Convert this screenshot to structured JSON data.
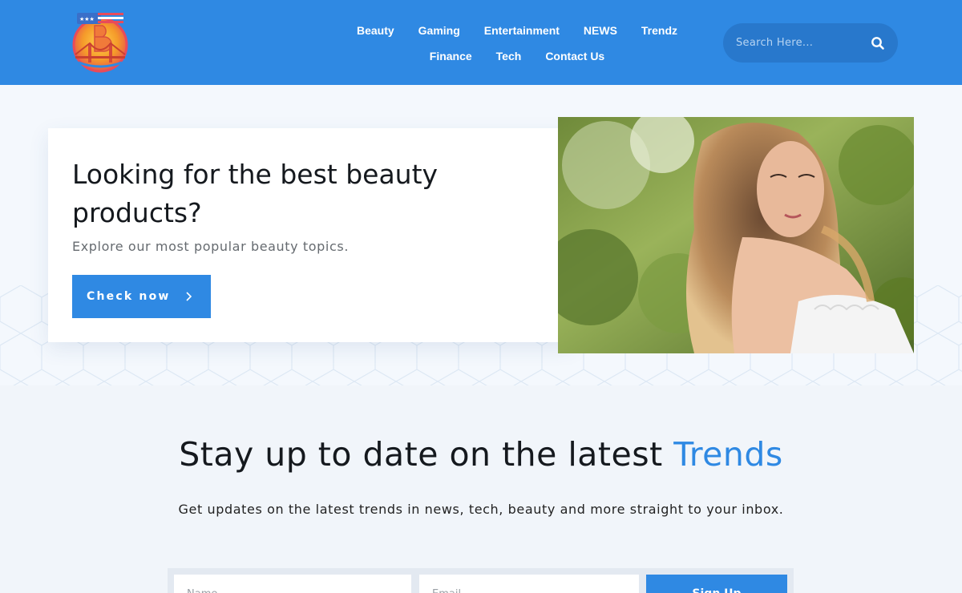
{
  "header": {
    "nav_row1": [
      {
        "label": "Beauty"
      },
      {
        "label": "Gaming"
      },
      {
        "label": "Entertainment"
      },
      {
        "label": "NEWS"
      },
      {
        "label": "Trendz"
      }
    ],
    "nav_row2": [
      {
        "label": "Finance"
      },
      {
        "label": "Tech"
      },
      {
        "label": "Contact Us"
      }
    ],
    "search": {
      "placeholder": "Search Here...",
      "icon": "search-icon"
    },
    "brand_color": "#2f89e3"
  },
  "hero": {
    "title": "Looking for the best beauty products?",
    "subtitle": "Explore our most popular beauty topics.",
    "button_label": "Check now",
    "button_icon": "chevron-right-icon"
  },
  "trends": {
    "title_prefix": "Stay up to date on the latest ",
    "title_accent": "Trends",
    "subtitle": "Get updates on the latest trends in news, tech, beauty and more straight to your inbox.",
    "form": {
      "name_placeholder": "Name",
      "email_placeholder": "Email",
      "submit_label": "Sign Up"
    }
  }
}
